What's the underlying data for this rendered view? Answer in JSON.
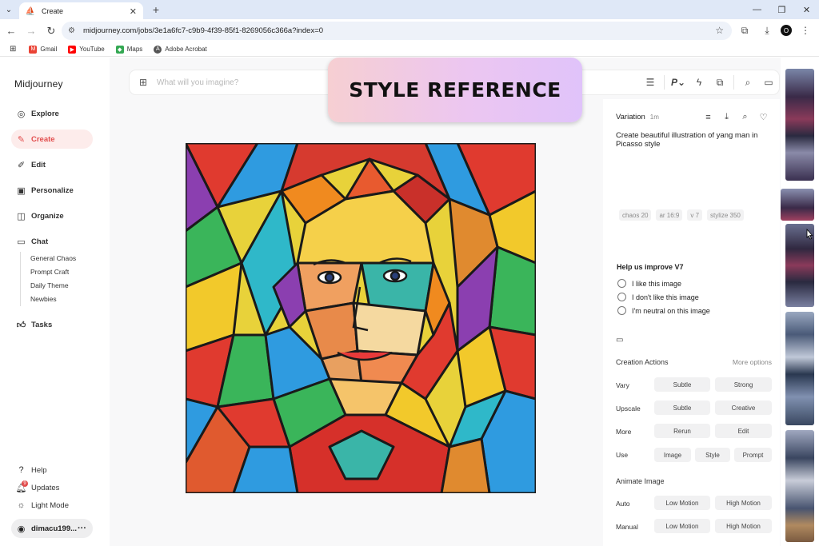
{
  "browser": {
    "tab_title": "Create",
    "url": "midjourney.com/jobs/3e1a6fc7-c9b9-4f39-85f1-8269056c366a?index=0",
    "bookmarks": [
      "Gmail",
      "YouTube",
      "Maps",
      "Adobe Acrobat"
    ],
    "profile_initial": "O"
  },
  "sidebar": {
    "brand": "Midjourney",
    "items": [
      {
        "label": "Explore",
        "icon": "compass-icon"
      },
      {
        "label": "Create",
        "icon": "paintbrush-icon",
        "active": true
      },
      {
        "label": "Edit",
        "icon": "edit-icon"
      },
      {
        "label": "Personalize",
        "icon": "image-icon"
      },
      {
        "label": "Organize",
        "icon": "gallery-icon"
      },
      {
        "label": "Chat",
        "icon": "chat-icon"
      },
      {
        "label": "Tasks",
        "icon": "thumbs-up-icon"
      }
    ],
    "chat_rooms": [
      "General Chaos",
      "Prompt Craft",
      "Daily Theme",
      "Newbies"
    ],
    "footer": [
      {
        "label": "Help",
        "icon": "help-icon"
      },
      {
        "label": "Updates",
        "icon": "bell-icon",
        "badge": "9"
      },
      {
        "label": "Light Mode",
        "icon": "sun-icon"
      }
    ],
    "user": "dimacu199..."
  },
  "prompt": {
    "placeholder": "What will you imagine?"
  },
  "banner": {
    "text": "STYLE REFERENCE"
  },
  "detail": {
    "header": "Variation",
    "age": "1m",
    "prompt_text": "Create beautiful illustration of yang man in Picasso style",
    "params": [
      "chaos 20",
      "ar 16:9",
      "v 7",
      "stylize 350"
    ],
    "improve_title": "Help us improve V7",
    "feedback": [
      "I like this image",
      "I don't like this image",
      "I'm neutral on this image"
    ],
    "creation_actions_title": "Creation Actions",
    "more_options": "More options",
    "rows": [
      {
        "label": "Vary",
        "buttons": [
          "Subtle",
          "Strong"
        ]
      },
      {
        "label": "Upscale",
        "buttons": [
          "Subtle",
          "Creative"
        ]
      },
      {
        "label": "More",
        "buttons": [
          "Rerun",
          "Edit"
        ]
      },
      {
        "label": "Use",
        "buttons": [
          "Image",
          "Style",
          "Prompt"
        ]
      }
    ],
    "animate_title": "Animate Image",
    "animate_rows": [
      {
        "label": "Auto",
        "buttons": [
          "Low Motion",
          "High Motion"
        ]
      },
      {
        "label": "Manual",
        "buttons": [
          "Low Motion",
          "High Motion"
        ]
      }
    ]
  },
  "colors": {
    "accent": "#e24d4d",
    "active_bg": "#fdeceb",
    "banner_left": "#f6cfd2",
    "banner_right": "#e0c3fa"
  }
}
